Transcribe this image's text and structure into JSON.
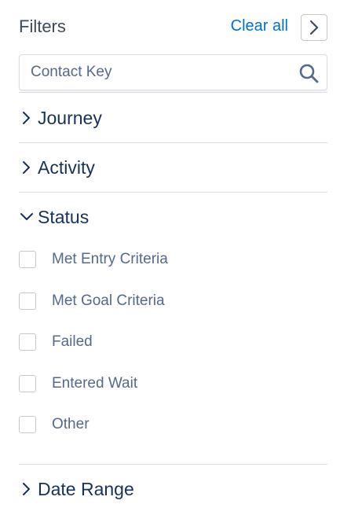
{
  "header": {
    "title": "Filters",
    "clear_all_label": "Clear all",
    "collapse_icon": "chevron-right-icon"
  },
  "search": {
    "placeholder": "Contact Key",
    "value": "",
    "icon": "search-icon"
  },
  "sections": [
    {
      "label": "Journey",
      "expanded": false
    },
    {
      "label": "Activity",
      "expanded": false
    },
    {
      "label": "Status",
      "expanded": true,
      "options": [
        {
          "label": "Met Entry Criteria",
          "checked": false
        },
        {
          "label": "Met Goal Criteria",
          "checked": false
        },
        {
          "label": "Failed",
          "checked": false
        },
        {
          "label": "Entered Wait",
          "checked": false
        },
        {
          "label": "Other",
          "checked": false
        }
      ]
    },
    {
      "label": "Date Range",
      "expanded": false
    }
  ],
  "colors": {
    "accent": "#0070d2",
    "text": "#16325c",
    "muted": "#54698d",
    "border": "#d8dde6"
  }
}
